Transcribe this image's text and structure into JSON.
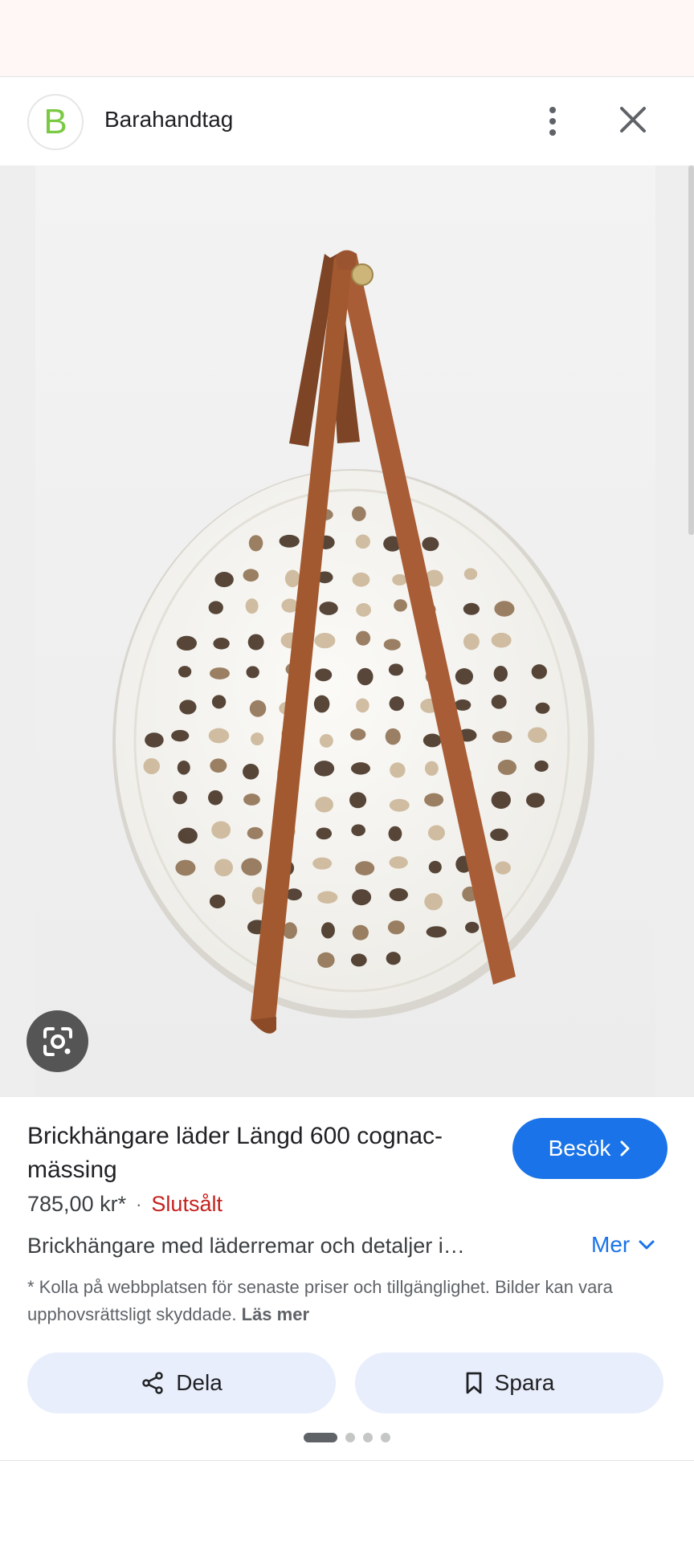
{
  "header": {
    "logo_letter": "B",
    "site_name": "Barahandtag",
    "more_icon": "more-vert-icon",
    "close_icon": "close-icon"
  },
  "image": {
    "lens_icon": "google-lens-icon"
  },
  "product": {
    "title": "Brickhängare läder Längd 600 cognac-mässing",
    "visit_label": "Besök",
    "price": "785,00 kr*",
    "separator": "·",
    "stock_status": "Slutsålt",
    "description": "Brickhängare med läderremar och detaljer i…",
    "more_label": "Mer",
    "disclaimer": "* Kolla på webbplatsen för senaste priser och tillgänglighet. Bilder kan vara upphovsrättsligt skyddade.",
    "read_more": "Läs mer"
  },
  "actions": {
    "share_label": "Dela",
    "save_label": "Spara"
  },
  "pager": {
    "total": 4,
    "active_index": 0
  },
  "colors": {
    "accent": "#1a73e8",
    "sold_out": "#c5221f",
    "button_bg": "#e8eefb",
    "leather": "#a85d36",
    "logo_green": "#7ac943"
  }
}
